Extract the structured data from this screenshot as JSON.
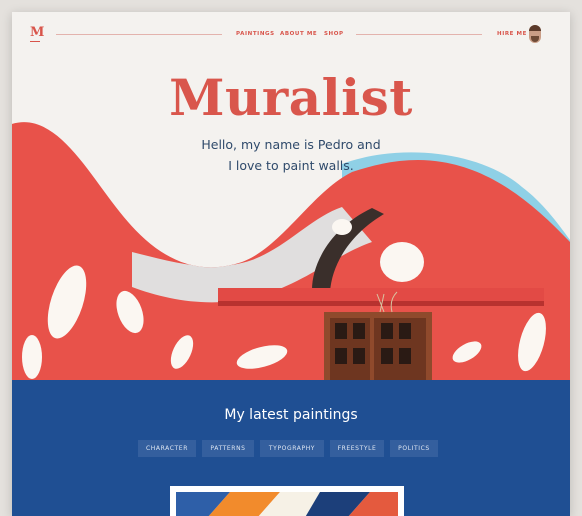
{
  "brand": {
    "logo": "M"
  },
  "nav": {
    "links": [
      "PAINTINGS",
      "ABOUT ME",
      "SHOP"
    ],
    "hire": "HIRE ME"
  },
  "hero": {
    "title": "Muralist",
    "tagline_line1": "Hello, my name is Pedro and",
    "tagline_line2": "I love to paint walls."
  },
  "latest": {
    "heading": "My latest paintings",
    "categories": [
      "CHARACTER",
      "PATTERNS",
      "TYPOGRAPHY",
      "FREESTYLE",
      "POLITICS"
    ]
  },
  "colors": {
    "accent": "#d8544a",
    "blue": "#1f4f93",
    "text_dark": "#2f4a6b"
  }
}
